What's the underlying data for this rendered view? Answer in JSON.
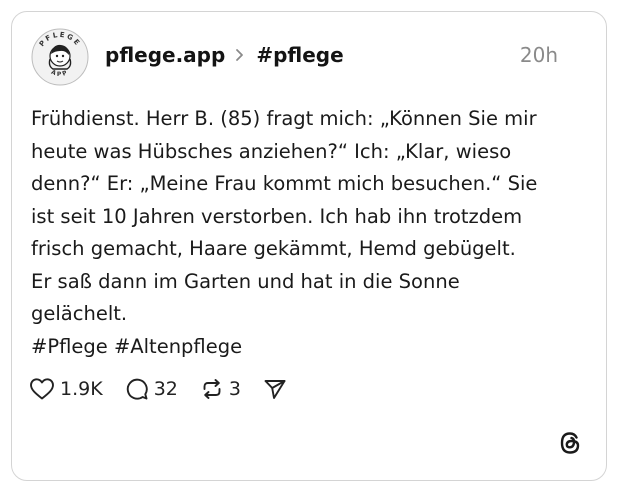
{
  "post": {
    "author": "pflege.app",
    "topic": "#pflege",
    "timestamp": "20h",
    "lines": [
      "Frühdienst. Herr B. (85) fragt mich: „Können Sie mir",
      "heute was Hübsches anziehen?“ Ich: „Klar, wieso",
      "denn?“ Er: „Meine Frau kommt mich besuchen.“ Sie",
      "ist seit 10 Jahren verstorben. Ich hab ihn trotzdem",
      "frisch gemacht, Haare gekämmt, Hemd gebügelt.",
      "Er saß dann im Garten und hat in die Sonne",
      "gelächelt.",
      "#Pflege #Altenpflege"
    ]
  },
  "avatar": {
    "top_text": "PFLEGE",
    "bottom_text": "APP"
  },
  "actions": {
    "likes": "1.9K",
    "replies": "32",
    "reposts": "3"
  },
  "icons": {
    "like": "heart-icon",
    "reply": "comment-icon",
    "repost": "repost-icon",
    "share": "send-icon",
    "brand": "threads-logo-icon"
  }
}
